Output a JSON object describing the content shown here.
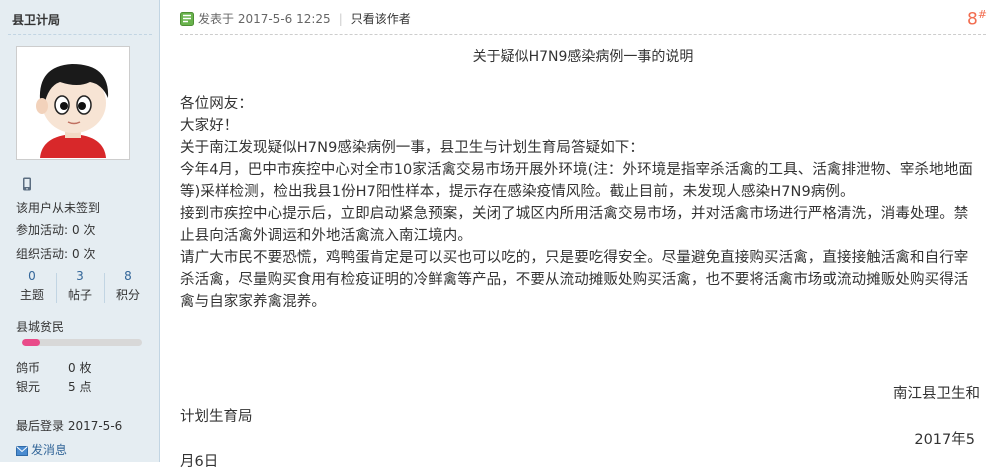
{
  "user": {
    "name": "县卫计局",
    "checkin_status": "该用户从未签到",
    "join_activity_label": "参加活动:",
    "join_activity_value": "0 次",
    "org_activity_label": "组织活动:",
    "org_activity_value": "0 次",
    "stats": [
      {
        "num": "0",
        "label": "主题"
      },
      {
        "num": "3",
        "label": "帖子"
      },
      {
        "num": "8",
        "label": "积分"
      }
    ],
    "level": "县城贫民",
    "level_progress": 0.15,
    "currency": [
      {
        "k": "鸽币",
        "v": "0 枚"
      },
      {
        "k": "银元",
        "v": "5 点"
      }
    ],
    "last_login": "最后登录 2017-5-6",
    "send_message": "发消息"
  },
  "post": {
    "posted_at": "发表于 2017-5-6 12:25",
    "author_only": "只看该作者",
    "floor": "8",
    "floor_mark": "#",
    "title": "关于疑似H7N9感染病例一事的说明",
    "paragraphs": [
      "各位网友：",
      "大家好！",
      "关于南江发现疑似H7N9感染病例一事，县卫生与计划生育局答疑如下：",
      "今年4月，巴中市疾控中心对全市10家活禽交易市场开展外环境(注：外环境是指宰杀活禽的工具、活禽排泄物、宰杀地地面等)采样检测，检出我县1份H7阳性样本，提示存在感染疫情风险。截止目前，未发现人感染H7N9病例。",
      "接到市疾控中心提示后，立即启动紧急预案，关闭了城区内所用活禽交易市场，并对活禽市场进行严格清洗，消毒处理。禁止县向活禽外调运和外地活禽流入南江境内。",
      "请广大市民不要恐慌，鸡鸭蛋肯定是可以买也可以吃的，只是要吃得安全。尽量避免直接购买活禽，直接接触活禽和自行宰杀活禽，尽量购买食用有检疫证明的冷鲜禽等产品，不要从流动摊贩处购买活禽，也不要将活禽市场或流动摊贩处购买得活禽与自家家养禽混养。"
    ],
    "sign_org_part1": "南江县卫生和",
    "sign_org_part2": "计划生育局",
    "sign_date_part1": "2017年5",
    "sign_date_part2": "月6日"
  },
  "colors": {
    "side_bg": "#e5edf2",
    "floor": "#f26c4f",
    "link": "#336699",
    "level_fill": "#e94b8a"
  }
}
